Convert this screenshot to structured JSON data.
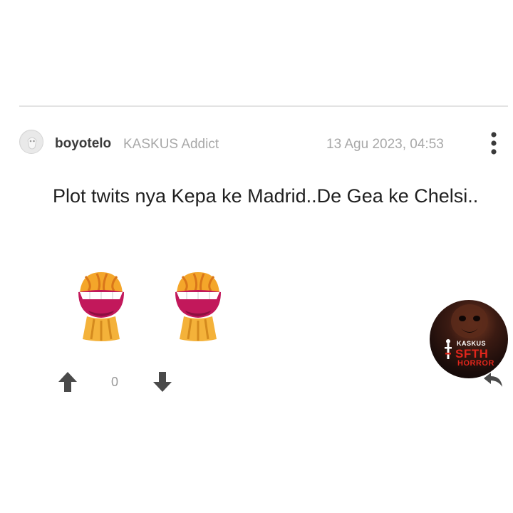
{
  "post": {
    "author": {
      "username": "boyotelo",
      "rank": "KASKUS Addict",
      "avatar_icon": "default-avatar-icon"
    },
    "timestamp": "13 Agu 2023, 04:53",
    "body": "Plot twits nya Kepa ke Madrid..De Gea ke Chelsi..",
    "emoticons": [
      "laughing-emoticon",
      "laughing-emoticon"
    ],
    "votes": {
      "count": "0",
      "upvote_icon": "arrow-up-icon",
      "downvote_icon": "arrow-down-icon"
    },
    "more_icon": "vertical-dots-icon",
    "reply_icon": "reply-icon"
  },
  "promo_badge": {
    "brand": "KASKUS",
    "title_line1": "SFTH",
    "title_line2": "HORROR",
    "colors": {
      "title": "#e0261c",
      "brand": "#ffffff",
      "background": "#1a0c0a"
    }
  },
  "colors": {
    "divider": "#e3e3e3",
    "meta_text": "#a8a8a8",
    "icon_dark": "#4a4a4a",
    "emoticon_gold": "#f4a62a",
    "emoticon_mouth": "#c2185b"
  }
}
